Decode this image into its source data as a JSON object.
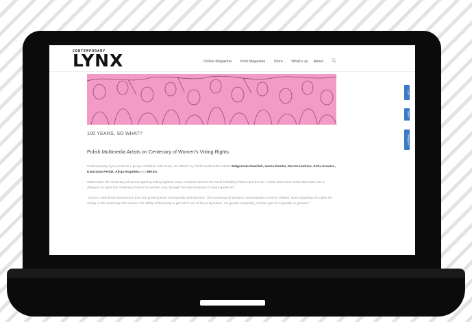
{
  "header": {
    "logo_small": "CONTEMPORARY",
    "logo_big": "LYNX",
    "nav": [
      {
        "label": "Online Magazine",
        "has_dropdown": true
      },
      {
        "label": "Print Magazine",
        "has_dropdown": true
      },
      {
        "label": "Store",
        "has_dropdown": true
      },
      {
        "label": "What's up",
        "has_dropdown": false
      },
      {
        "label": "About",
        "has_dropdown": true
      }
    ],
    "dropdown_glyph": "⌄",
    "search_icon": "search-icon"
  },
  "social": [
    {
      "label": "Like"
    },
    {
      "label": "Share"
    },
    {
      "label": "Instagram"
    }
  ],
  "article": {
    "title": "100 YEARS, SO WHAT?",
    "subtitle": "Polish Multimedia Artists on Centenary of Women's Voting Rights",
    "p1_intro": "Contemporary Lynx presents a group exhibition '100 Years, So What?' by Polish multimedia artists:",
    "p1_artists_a": "Małgorzata Dawidek, Iwona Demko, Dorota Hadrian, Zofia Krawiec, Katarzyna Perlak, Alicja Rogalska",
    "p1_and": "and",
    "p1_artists_b": "BIKSA.",
    "p2": "2018 marks the centenary of women gaining voting rights in many countries around the world including Poland and the UK. Artists show their works that enter into a dialogue on what this centenary means for women now, through the new mediums of avant-garde art.",
    "p3": "\"Lenny's sixth book-manuscripts from the growing level of inequality and injustice. The centenary of women's emancipatory event in Poland, since obtaining the rights for voting, is the centenary that women the ability of humanity to get rid of one of these injustices. He gender inequality, perhaps get rid of gender in general.\""
  },
  "colors": {
    "hero_pink": "#f39ac7",
    "social_blue": "#3b7bc6",
    "laptop_black": "#0b0b0b"
  }
}
